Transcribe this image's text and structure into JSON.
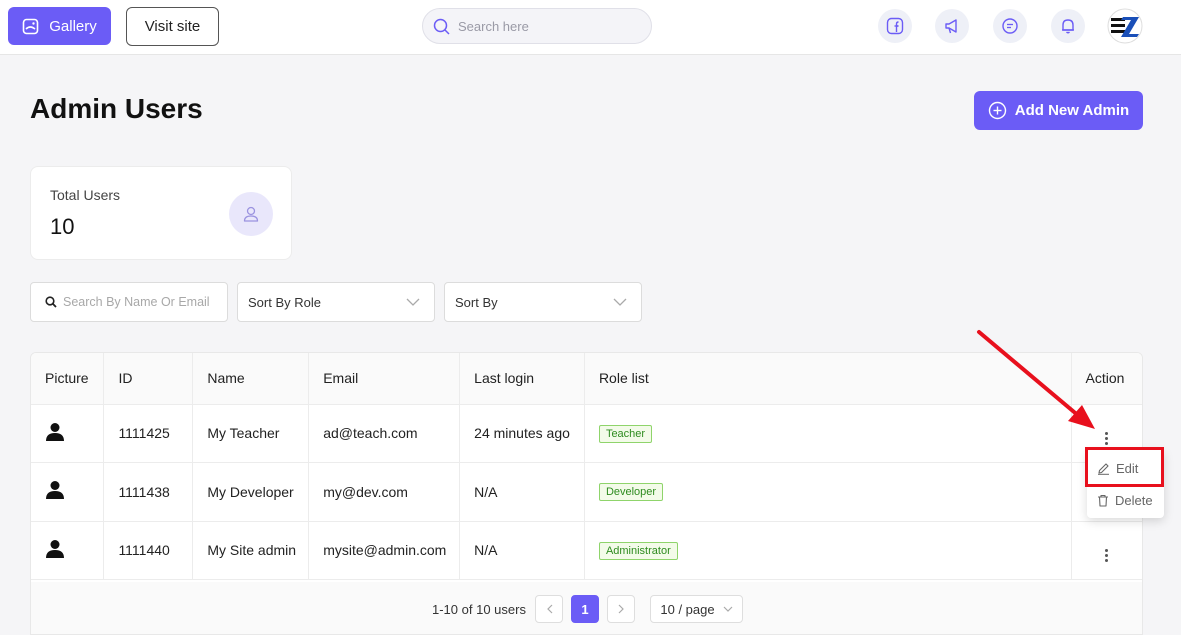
{
  "topbar": {
    "gallery_label": "Gallery",
    "visit_label": "Visit site",
    "search_placeholder": "Search here",
    "icons": [
      "facebook-icon",
      "megaphone-icon",
      "chat-icon",
      "bell-icon"
    ]
  },
  "page": {
    "title": "Admin Users",
    "add_button": "Add New Admin"
  },
  "stats": {
    "label": "Total Users",
    "value": "10"
  },
  "filters": {
    "search_placeholder": "Search By Name Or Email",
    "role_select": "Sort By Role",
    "sort_select": "Sort By"
  },
  "table": {
    "columns": [
      "Picture",
      "ID",
      "Name",
      "Email",
      "Last login",
      "Role list",
      "Action"
    ],
    "rows": [
      {
        "id": "1111425",
        "name": "My Teacher",
        "email": "ad@teach.com",
        "last_login": "24 minutes ago",
        "role": "Teacher"
      },
      {
        "id": "1111438",
        "name": "My Developer",
        "email": "my@dev.com",
        "last_login": "N/A",
        "role": "Developer"
      },
      {
        "id": "1111440",
        "name": "My Site admin",
        "email": "mysite@admin.com",
        "last_login": "N/A",
        "role": "Administrator"
      }
    ]
  },
  "pagination": {
    "summary": "1-10 of 10 users",
    "current_page": "1",
    "page_size": "10 / page"
  },
  "action_menu": {
    "edit": "Edit",
    "delete": "Delete"
  },
  "colors": {
    "accent": "#6b5cf6",
    "highlight": "#e8101d",
    "tag_green": "#2e8b1f"
  }
}
